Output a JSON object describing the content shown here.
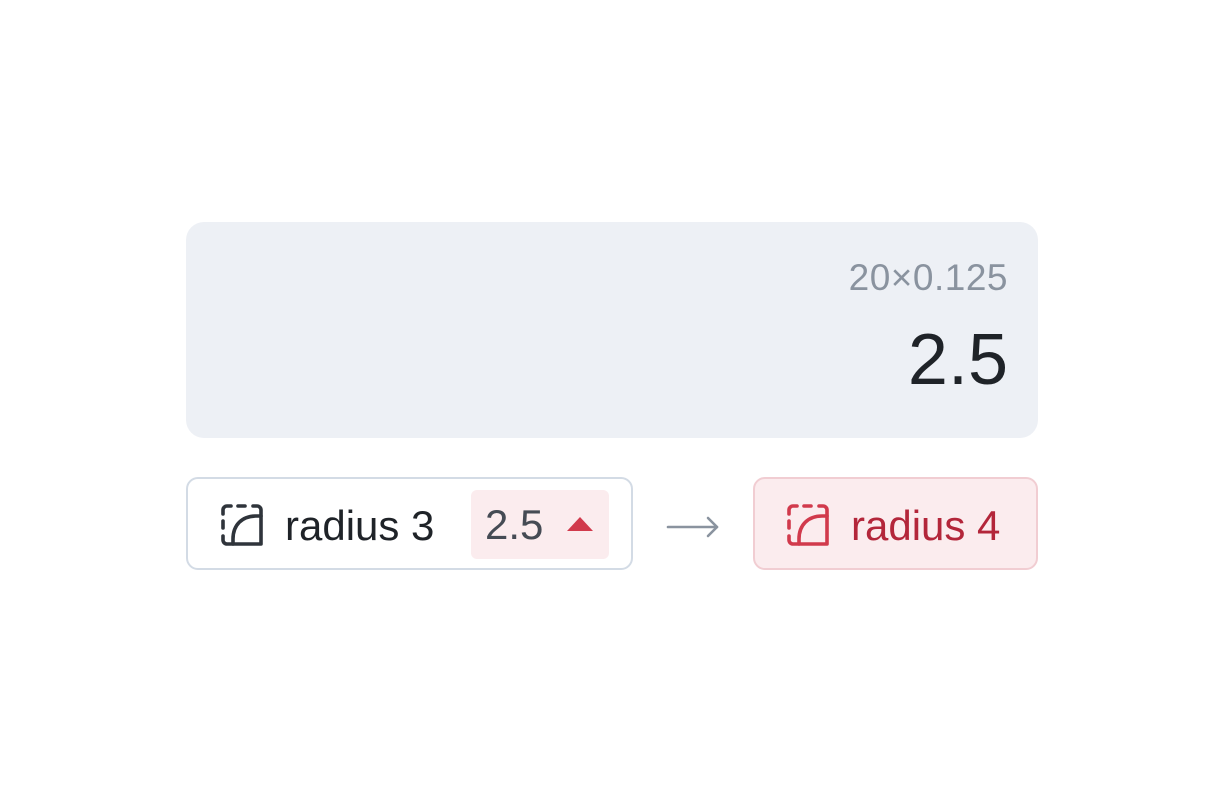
{
  "display": {
    "expression": "20×0.125",
    "result": "2.5"
  },
  "current_token": {
    "icon": "radius-icon",
    "label": "radius 3",
    "computed_value": "2.5",
    "trend_icon": "triangle-up-icon"
  },
  "flow": {
    "icon": "arrow-right-icon"
  },
  "next_token": {
    "icon": "radius-icon",
    "label": "radius 4"
  },
  "colors": {
    "display_bg": "#edf0f5",
    "text_primary": "#1f2328",
    "text_muted": "#8a939f",
    "accent_red": "#d13a4c",
    "accent_red_text": "#b3263a",
    "accent_red_bg": "#fbecee",
    "border_neutral": "#d3dbe5"
  }
}
